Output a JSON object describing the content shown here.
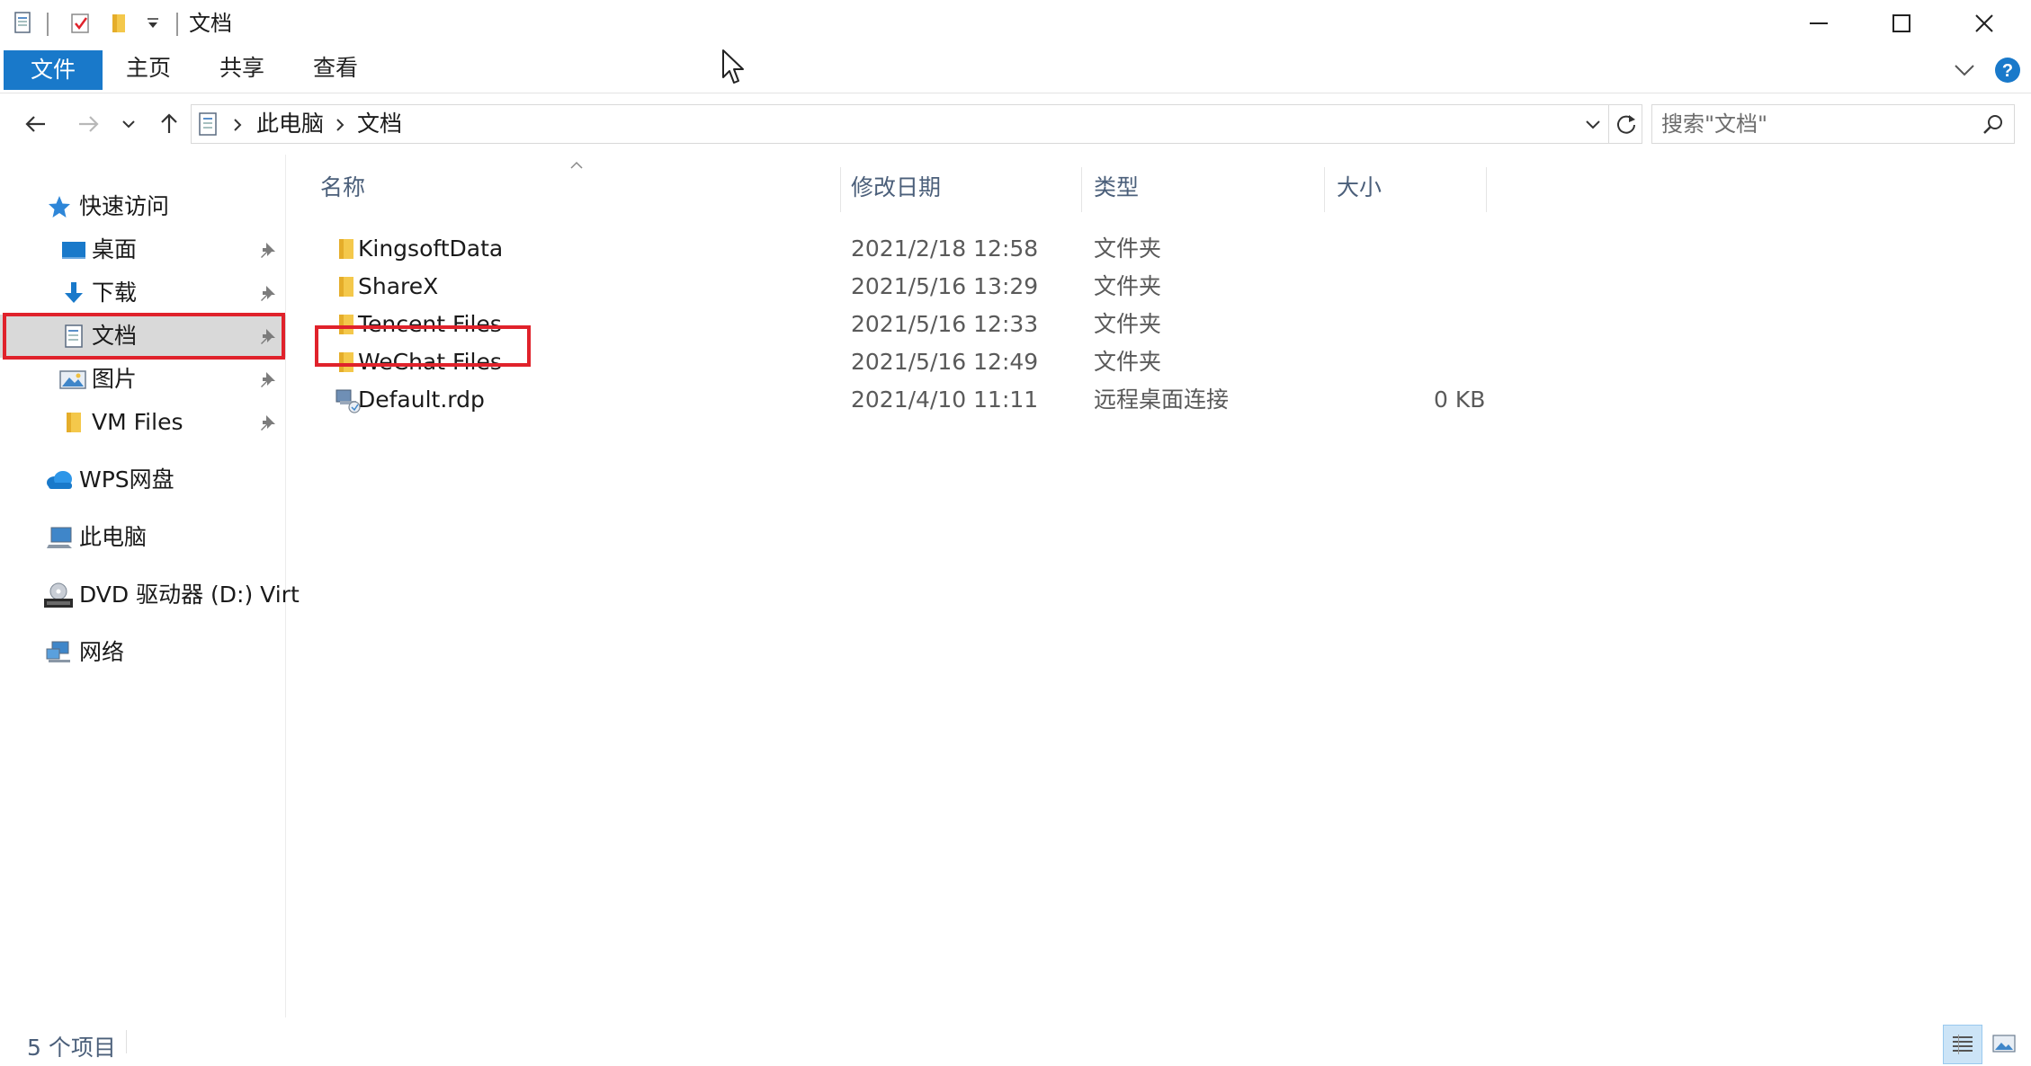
{
  "window": {
    "title": "文档"
  },
  "ribbon": {
    "tabs": [
      {
        "label": "文件"
      },
      {
        "label": "主页"
      },
      {
        "label": "共享"
      },
      {
        "label": "查看"
      }
    ]
  },
  "address": {
    "crumbs": [
      "此电脑",
      "文档"
    ],
    "search_placeholder": "搜索\"文档\""
  },
  "sidebar": {
    "quick_access": "快速访问",
    "items": [
      {
        "label": "桌面",
        "icon": "desktop-icon",
        "pinned": true
      },
      {
        "label": "下载",
        "icon": "download-icon",
        "pinned": true
      },
      {
        "label": "文档",
        "icon": "documents-icon",
        "pinned": true,
        "selected": true
      },
      {
        "label": "图片",
        "icon": "pictures-icon",
        "pinned": true
      },
      {
        "label": "VM Files",
        "icon": "folder-icon",
        "pinned": true
      }
    ],
    "wps": "WPS网盘",
    "this_pc": "此电脑",
    "dvd": "DVD 驱动器 (D:) Virt",
    "network": "网络"
  },
  "list": {
    "columns": {
      "name": "名称",
      "modified": "修改日期",
      "type": "类型",
      "size": "大小"
    },
    "rows": [
      {
        "name": "KingsoftData",
        "modified": "2021/2/18 12:58",
        "type": "文件夹",
        "size": "",
        "icon": "folder-icon"
      },
      {
        "name": "ShareX",
        "modified": "2021/5/16 13:29",
        "type": "文件夹",
        "size": "",
        "icon": "folder-icon"
      },
      {
        "name": "Tencent Files",
        "modified": "2021/5/16 12:33",
        "type": "文件夹",
        "size": "",
        "icon": "folder-icon"
      },
      {
        "name": "WeChat Files",
        "modified": "2021/5/16 12:49",
        "type": "文件夹",
        "size": "",
        "icon": "folder-icon",
        "highlighted": true
      },
      {
        "name": "Default.rdp",
        "modified": "2021/4/10 11:11",
        "type": "远程桌面连接",
        "size": "0 KB",
        "icon": "rdp-file-icon"
      }
    ]
  },
  "status": {
    "item_count": "5 个项目"
  },
  "colors": {
    "accent": "#1979ca",
    "highlight": "#e0222b",
    "selected_bg": "#d9d9d9",
    "folder": "#f4c84b"
  }
}
